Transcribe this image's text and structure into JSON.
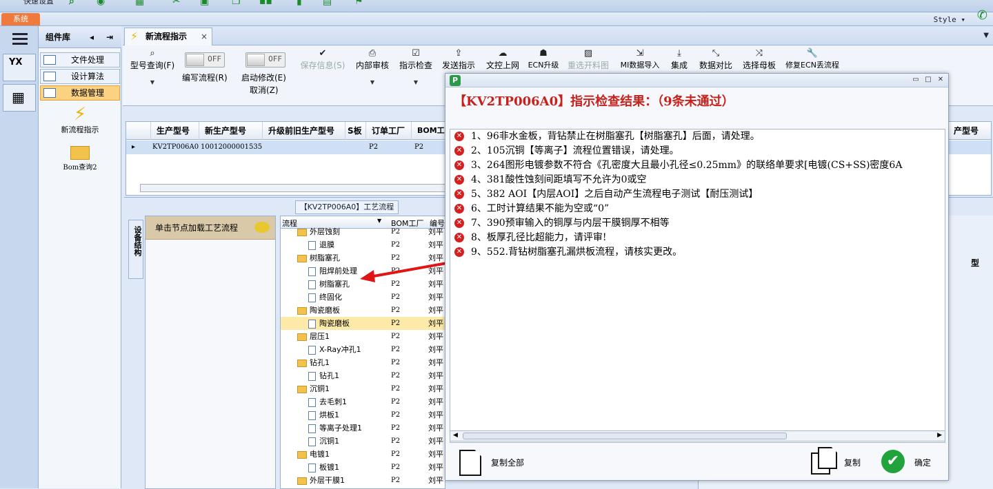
{
  "app": {
    "quick_access": "快速设置",
    "system_tab": "系统",
    "style_label": "Style ▾"
  },
  "library": {
    "title": "组件库",
    "items": [
      {
        "label": "文件处理"
      },
      {
        "label": "设计算法"
      },
      {
        "label": "数据管理",
        "selected": true
      }
    ],
    "tools": [
      {
        "label": "新流程指示",
        "icon": "lightning-icon"
      },
      {
        "label": "Bom查询2",
        "icon": "folder-icon"
      }
    ]
  },
  "doc_tab": {
    "label": "新流程指示",
    "close": "×"
  },
  "toolbar": {
    "model_query": "型号查询(F)",
    "write_flow": "编写流程(R)",
    "write_toggle": "OFF",
    "enable_modify": "启动修改(E)",
    "modify_toggle": "OFF",
    "cancel": "取消(Z)",
    "save_info": "保存信息(S)",
    "internal_review": "内部审核",
    "instruction_check": "指示检查",
    "send_instruction": "发送指示",
    "doc_online": "文控上网",
    "ecn_upgrade": "ECN升级",
    "reselect_drawing": "重选开料图",
    "mi_import": "MI数据导入",
    "integrate": "集成",
    "data_compare": "数据对比",
    "select_master": "选择母板",
    "repair_ecn": "修复ECN丢流程"
  },
  "grid": {
    "headers": [
      "生产型号",
      "新生产型号",
      "升级前旧生产型号",
      "S板",
      "订单工厂",
      "BOM工厂",
      "产型号"
    ],
    "row": {
      "model": "KV2TP006A0",
      "new_model": "10012000001535",
      "order_factory": "P2",
      "bom_factory": "P2"
    }
  },
  "process": {
    "tab": "【KV2TP006A0】工艺流程",
    "vertical_tab": "设备结构",
    "node_hint": "单击节点加载工艺流程",
    "tree_headers": {
      "flow": "流程",
      "bom": "BOM工厂",
      "code": "编号"
    },
    "rows": [
      {
        "name": "外层蚀刻",
        "type": "folder",
        "bom": "P2",
        "code": "刘平"
      },
      {
        "name": "退膜",
        "type": "page",
        "bom": "P2",
        "code": "刘平"
      },
      {
        "name": "树脂塞孔",
        "type": "folder",
        "bom": "P2",
        "code": "刘平"
      },
      {
        "name": "阻焊前处理",
        "type": "page",
        "bom": "P2",
        "code": "刘平"
      },
      {
        "name": "树脂塞孔",
        "type": "page",
        "bom": "P2",
        "code": "刘平"
      },
      {
        "name": "终固化",
        "type": "page",
        "bom": "P2",
        "code": "刘平"
      },
      {
        "name": "陶瓷磨板",
        "type": "folder",
        "bom": "P2",
        "code": "刘平"
      },
      {
        "name": "陶瓷磨板",
        "type": "page",
        "bom": "P2",
        "code": "刘平",
        "selected": true
      },
      {
        "name": "层压1",
        "type": "folder",
        "bom": "P2",
        "code": "刘平"
      },
      {
        "name": "X-Ray冲孔1",
        "type": "page",
        "bom": "P2",
        "code": "刘平"
      },
      {
        "name": "钻孔1",
        "type": "folder",
        "bom": "P2",
        "code": "刘平"
      },
      {
        "name": "钻孔1",
        "type": "page",
        "bom": "P2",
        "code": "刘平"
      },
      {
        "name": "沉铜1",
        "type": "folder",
        "bom": "P2",
        "code": "刘平"
      },
      {
        "name": "去毛刺1",
        "type": "page",
        "bom": "P2",
        "code": "刘平"
      },
      {
        "name": "烘板1",
        "type": "page",
        "bom": "P2",
        "code": "刘平"
      },
      {
        "name": "等离子处理1",
        "type": "page",
        "bom": "P2",
        "code": "刘平"
      },
      {
        "name": "沉铜1",
        "type": "page",
        "bom": "P2",
        "code": "刘平"
      },
      {
        "name": "电镀1",
        "type": "folder",
        "bom": "P2",
        "code": "刘平"
      },
      {
        "name": "板镀1",
        "type": "page",
        "bom": "P2",
        "code": "刘平"
      },
      {
        "name": "外层干膜1",
        "type": "folder",
        "bom": "P2",
        "code": "刘平"
      }
    ],
    "right_col": "型"
  },
  "dialog": {
    "title": "【KV2TP006A0】指示检查结果：（9条未通过）",
    "items": [
      "1、96非水金板，背钻禁止在树脂塞孔【树脂塞孔】后面，请处理。",
      "2、105沉铜【等离子】流程位置错误，请处理。",
      "3、264图形电镀参数不符合《孔密度大且最小孔径≤0.25mm》的联络单要求[电镀(CS+SS)密度6A",
      "4、381酸性蚀刻间距填写不允许为0或空",
      "5、382 AOI【内层AOI】之后自动产生流程电子测试【耐压测试】",
      "6、工时计算结果不能为空或“0”",
      "7、390预审输入的铜厚与内层干膜铜厚不相等",
      "8、板厚孔径比超能力，请评审!",
      "9、552.背钻树脂塞孔漏烘板流程，请核实更改。"
    ],
    "copy_all": "复制全部",
    "copy": "复制",
    "ok": "确定"
  }
}
